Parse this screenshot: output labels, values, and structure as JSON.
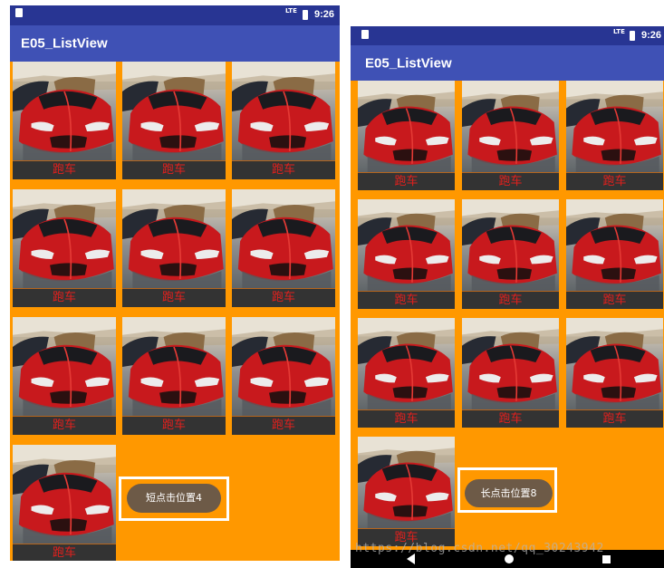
{
  "left_screen": {
    "status_time": "9:26",
    "lte": "LTE",
    "app_title": "E05_ListView",
    "items": [
      "跑车",
      "跑车",
      "跑车",
      "跑车",
      "跑车",
      "跑车",
      "跑车",
      "跑车",
      "跑车",
      "跑车"
    ],
    "toast": "短点击位置4"
  },
  "right_screen": {
    "status_time": "9:26",
    "lte": "LTE",
    "app_title": "E05_ListView",
    "items": [
      "跑车",
      "跑车",
      "跑车",
      "跑车",
      "跑车",
      "跑车",
      "跑车",
      "跑车",
      "跑车",
      "跑车"
    ],
    "toast": "长点击位置8"
  },
  "watermark": "https://blog.csdn.net/qq_30243942",
  "colors": {
    "status_bar": "#283593",
    "app_bar": "#3F51B5",
    "grid_background": "#FF9800",
    "label_text": "#E0201D",
    "toast": "#6D5A47"
  },
  "icons": [
    "sd-card-icon",
    "lte-signal-icon",
    "battery-icon",
    "back-icon",
    "home-icon",
    "recents-icon"
  ]
}
